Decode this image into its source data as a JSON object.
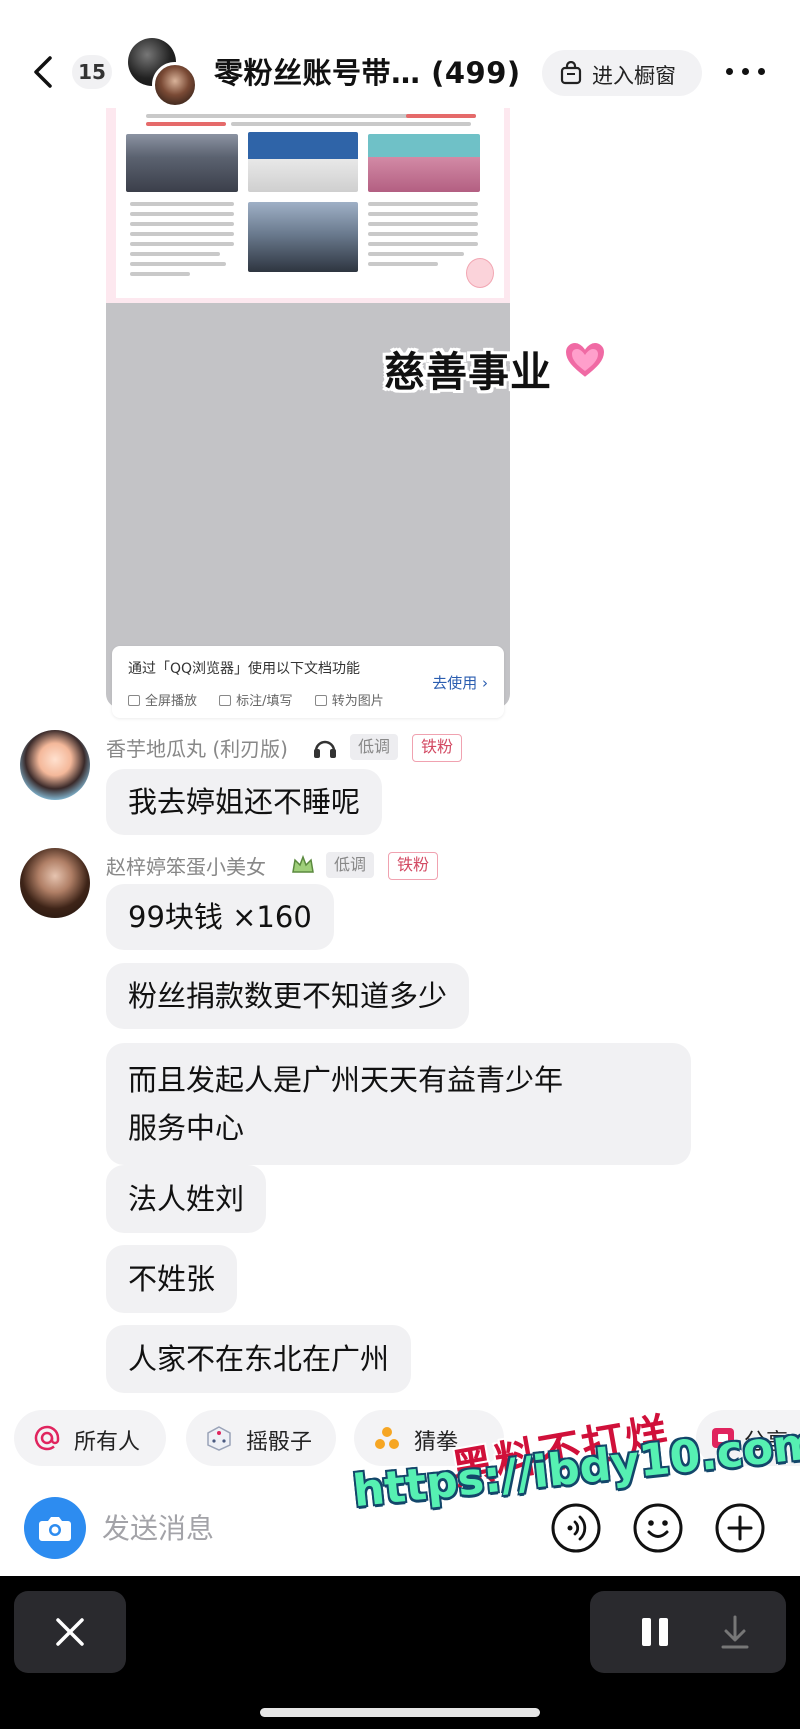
{
  "header": {
    "unread_count": "15",
    "group_title": "零粉丝账号带… (499)",
    "shop_label": "进入橱窗",
    "icons": {
      "back": "chevron-left-icon",
      "shop": "shopping-bag-icon",
      "more": "more-dots-icon"
    }
  },
  "shared_image": {
    "sticker_text": "慈善事业",
    "sticker_icon": "pink-heart-icon",
    "qq_card": {
      "title": "通过「QQ浏览器」使用以下文档功能",
      "action": "去使用 ›",
      "features": [
        "全屏播放",
        "标注/填写",
        "转为图片"
      ]
    }
  },
  "messages": [
    {
      "sender": "香芋地瓜丸 (利刃版)",
      "tags": [
        "低调",
        "铁粉"
      ],
      "bubbles": [
        "我去婷姐还不睡呢"
      ]
    },
    {
      "sender": "赵梓婷笨蛋小美女",
      "tags": [
        "低调",
        "铁粉"
      ],
      "bubbles": [
        "99块钱 ×160",
        "粉丝捐款数更不知道多少",
        "而且发起人是广州天天有益青少年",
        "服务中心",
        "法人姓刘",
        "不姓张",
        "人家不在东北在广州"
      ]
    }
  ],
  "chips": [
    {
      "label": "所有人",
      "icon": "at-icon"
    },
    {
      "label": "摇骰子",
      "icon": "dice-icon"
    },
    {
      "label": "猜拳",
      "icon": "rock-paper-scissors-icon"
    },
    {
      "label": "分享",
      "icon": "share-icon"
    }
  ],
  "input": {
    "placeholder": "发送消息",
    "icons": [
      "camera-icon",
      "voice-icon",
      "emoji-icon",
      "plus-icon"
    ]
  },
  "watermark": {
    "line1": "黑料不打烊",
    "line2": "https://ibdy10.com"
  },
  "colors": {
    "accent_blue": "#2d8cf0",
    "fan_tag_red": "#d34a63",
    "bubble_bg": "#f1f1f3",
    "watermark_red": "#d0103a",
    "watermark_green": "#56f0b2"
  }
}
